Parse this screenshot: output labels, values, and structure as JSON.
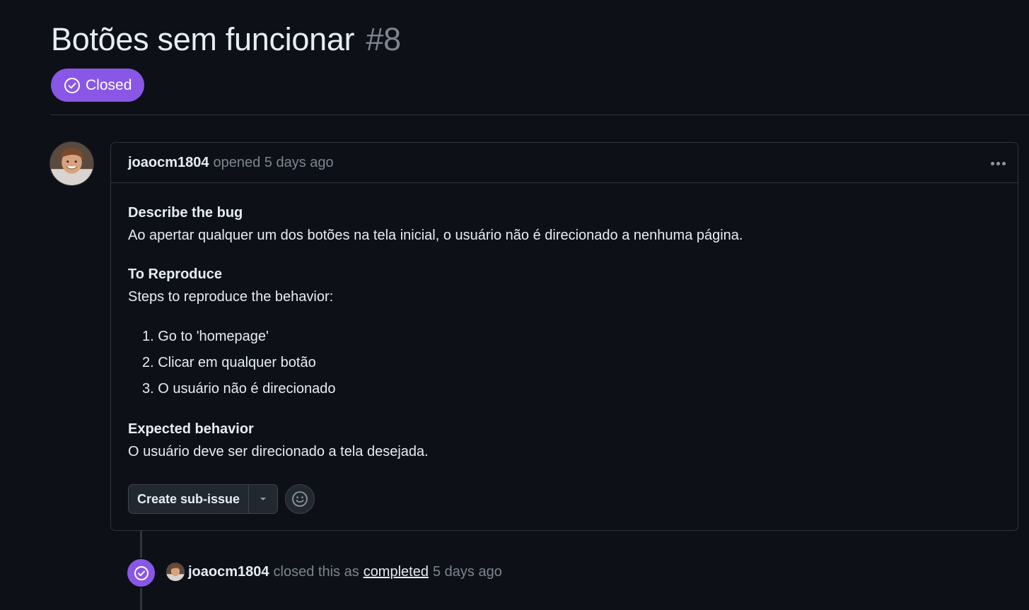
{
  "issue": {
    "title": "Botões sem funcionar",
    "number": "#8",
    "state": "Closed",
    "state_color": "#8957e5"
  },
  "comment": {
    "author": "joaocm1804",
    "action": "opened 5 days ago",
    "sections": [
      {
        "heading": "Describe the bug",
        "text": "Ao apertar qualquer um dos botões na tela inicial, o usuário não é direcionado a nenhuma página."
      },
      {
        "heading": "To Reproduce",
        "text": "Steps to reproduce the behavior:"
      },
      {
        "heading": "Expected behavior",
        "text": "O usuário deve ser direcionado a tela desejada."
      }
    ],
    "steps": [
      "1. Go to 'homepage'",
      "2. Clicar em qualquer botão",
      "3. O usuário não é direcionado"
    ],
    "create_sub_issue_label": "Create sub-issue",
    "menu_icon": "kebab-horizontal-icon",
    "reaction_icon": "smiley-icon"
  },
  "timeline_event": {
    "author": "joaocm1804",
    "text_before": "closed this as",
    "link_text": "completed",
    "time": "5 days ago",
    "icon": "check-circle-icon"
  }
}
